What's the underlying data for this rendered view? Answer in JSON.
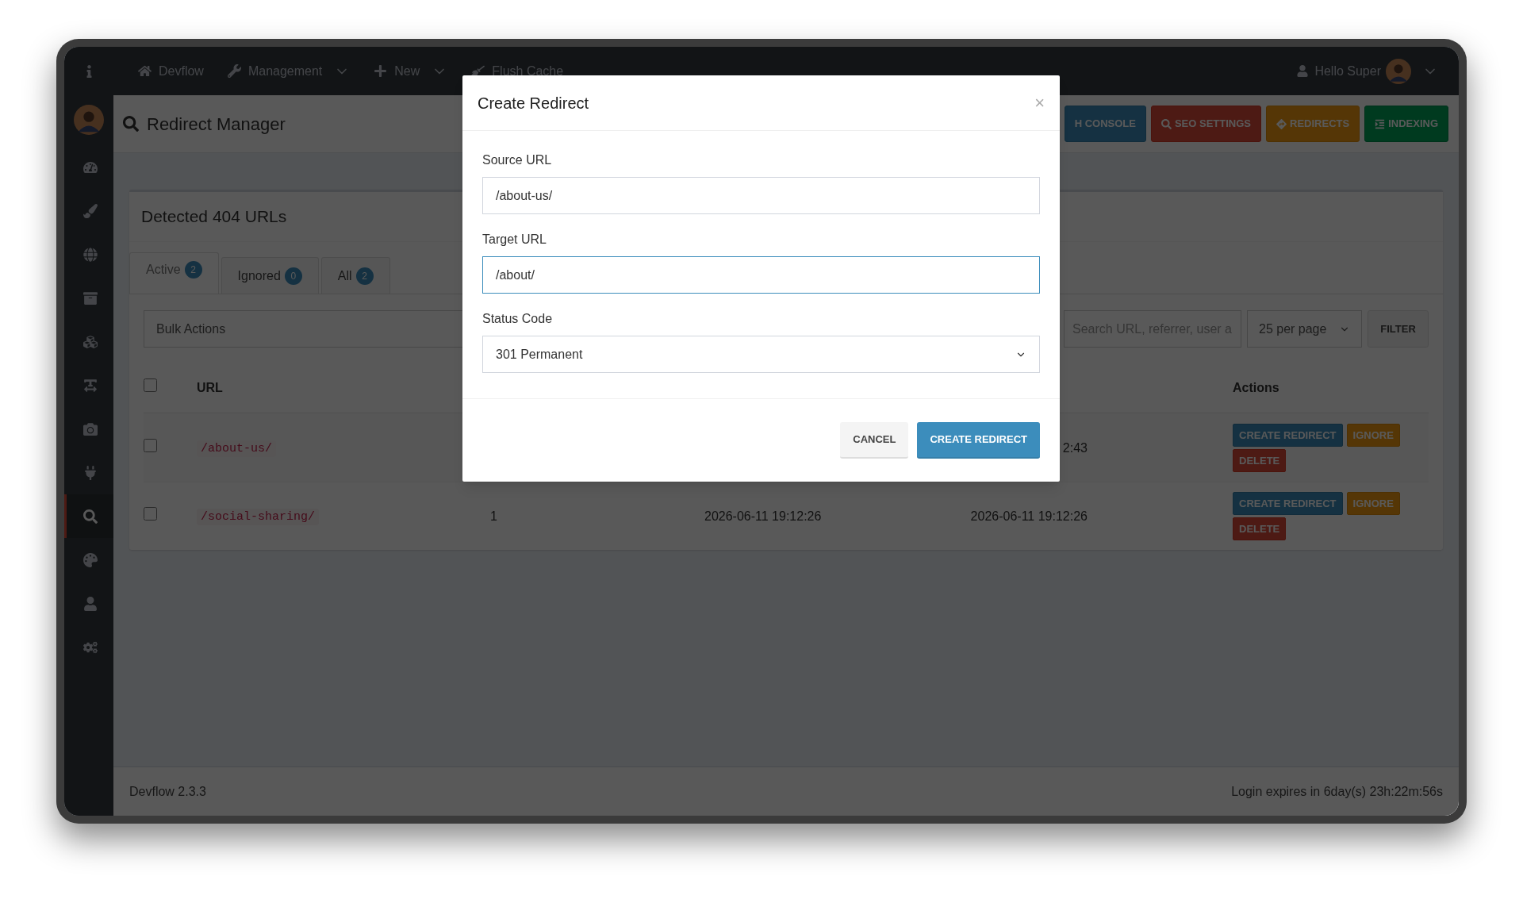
{
  "nav": {
    "items": [
      {
        "label": "Devflow",
        "dropdown": false
      },
      {
        "label": "Management",
        "dropdown": true
      },
      {
        "label": "New",
        "dropdown": true
      },
      {
        "label": "Flush Cache",
        "dropdown": false
      }
    ],
    "user": "Hello Super"
  },
  "sidebar": {
    "items": [
      {
        "selected": false
      },
      {
        "selected": false
      },
      {
        "selected": false
      },
      {
        "selected": false
      },
      {
        "selected": false
      },
      {
        "selected": false
      },
      {
        "selected": false
      },
      {
        "selected": false
      },
      {
        "selected": true
      },
      {
        "selected": false
      },
      {
        "selected": false
      },
      {
        "selected": false
      }
    ]
  },
  "header": {
    "title": "Redirect Manager",
    "buttons": [
      {
        "label": "H CONSOLE",
        "kind": "primary"
      },
      {
        "label": "SEO SETTINGS",
        "kind": "danger"
      },
      {
        "label": "REDIRECTS",
        "kind": "warning"
      },
      {
        "label": "INDEXING",
        "kind": "success"
      }
    ]
  },
  "card": {
    "title": "Detected 404 URLs",
    "tabs": [
      {
        "label": "Active",
        "count": "2",
        "selected": true
      },
      {
        "label": "Ignored",
        "count": "0",
        "selected": false
      },
      {
        "label": "All",
        "count": "2",
        "selected": false
      }
    ],
    "filters": {
      "bulk_actions": "Bulk Actions",
      "search_placeholder": "Search URL, referrer, user a",
      "per_page": "25 per page",
      "filter_button": "FILTER"
    },
    "table": {
      "select_all_checked": false,
      "url_header": "URL",
      "actions_header": "Actions",
      "rows": [
        {
          "checked": false,
          "url": "/about-us/",
          "last_seen": "2:43",
          "actions": [
            {
              "label": "CREATE REDIRECT",
              "kind": "primary"
            },
            {
              "label": "IGNORE",
              "kind": "warning"
            },
            {
              "label": "DELETE",
              "kind": "danger"
            }
          ]
        },
        {
          "checked": false,
          "url": "/social-sharing/",
          "hits": "1",
          "first_seen": "2026-06-11 19:12:26",
          "last_seen": "2026-06-11 19:12:26",
          "actions": [
            {
              "label": "CREATE REDIRECT",
              "kind": "primary"
            },
            {
              "label": "IGNORE",
              "kind": "warning"
            },
            {
              "label": "DELETE",
              "kind": "danger"
            }
          ]
        }
      ]
    }
  },
  "footer": {
    "version": "Devflow 2.3.3",
    "session": "Login expires in 6day(s) 23h:22m:56s"
  },
  "modal": {
    "title": "Create Redirect",
    "close": "×",
    "fields": [
      {
        "label": "Source URL",
        "value": "/about-us/",
        "kind": "text",
        "focused": false
      },
      {
        "label": "Target URL",
        "value": "/about/",
        "kind": "text",
        "focused": true
      },
      {
        "label": "Status Code",
        "value": "301 Permanent",
        "kind": "select",
        "focused": false
      }
    ],
    "buttons": [
      {
        "label": "CANCEL",
        "kind": "default"
      },
      {
        "label": "CREATE REDIRECT",
        "kind": "primary"
      }
    ]
  }
}
